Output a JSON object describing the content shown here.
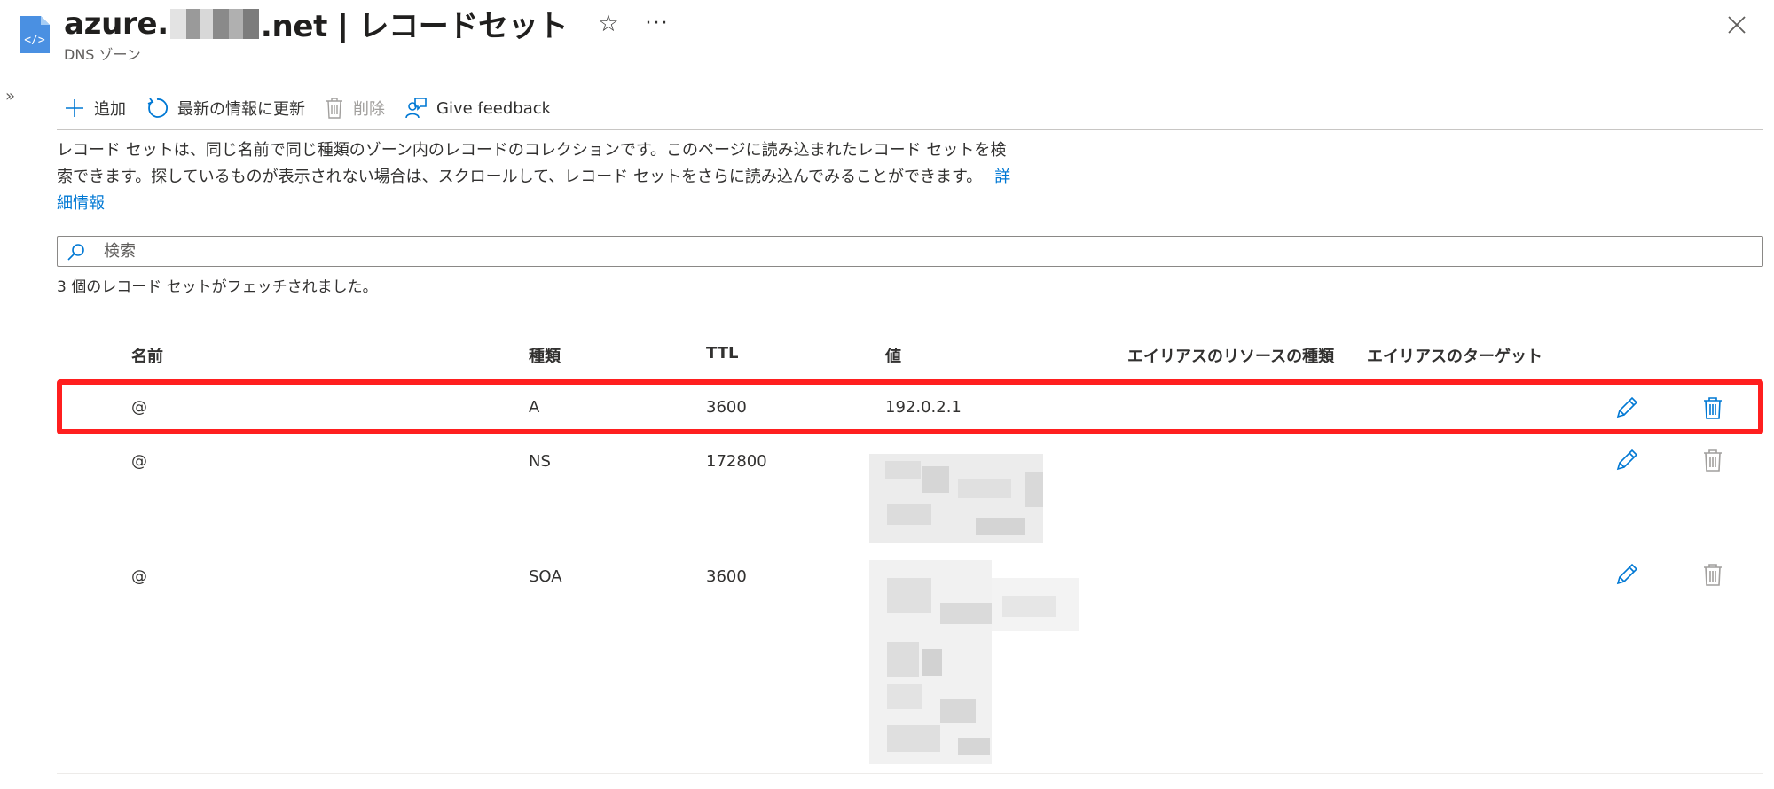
{
  "header": {
    "title_prefix": "azure.",
    "title_suffix": ".net | レコードセット",
    "subtitle": "DNS ゾーン",
    "star": "☆",
    "more": "···"
  },
  "nav": {
    "collapse": "»"
  },
  "toolbar": {
    "add": "追加",
    "refresh": "最新の情報に更新",
    "delete": "削除",
    "feedback": "Give feedback"
  },
  "description": {
    "text": "レコード セットは、同じ名前で同じ種類のゾーン内のレコードのコレクションです。このページに読み込まれたレコード セットを検索できます。探しているものが表示されない場合は、スクロールして、レコード セットをさらに読み込んでみることができます。",
    "link": "詳細情報"
  },
  "search": {
    "placeholder": "検索"
  },
  "fetch_status": "3 個のレコード セットがフェッチされました。",
  "table": {
    "columns": {
      "name": "名前",
      "type": "種類",
      "ttl": "TTL",
      "value": "値",
      "alias_resource_type": "エイリアスのリソースの種類",
      "alias_target": "エイリアスのターゲット"
    },
    "rows": [
      {
        "name": "@",
        "type": "A",
        "ttl": "3600",
        "value": "192.0.2.1",
        "selected": true
      },
      {
        "name": "@",
        "type": "NS",
        "ttl": "172800",
        "value": ""
      },
      {
        "name": "@",
        "type": "SOA",
        "ttl": "3600",
        "value": ""
      }
    ]
  },
  "colors": {
    "accent": "#0078d4",
    "highlight": "#ff1f1f",
    "disabled": "#a19f9d"
  }
}
